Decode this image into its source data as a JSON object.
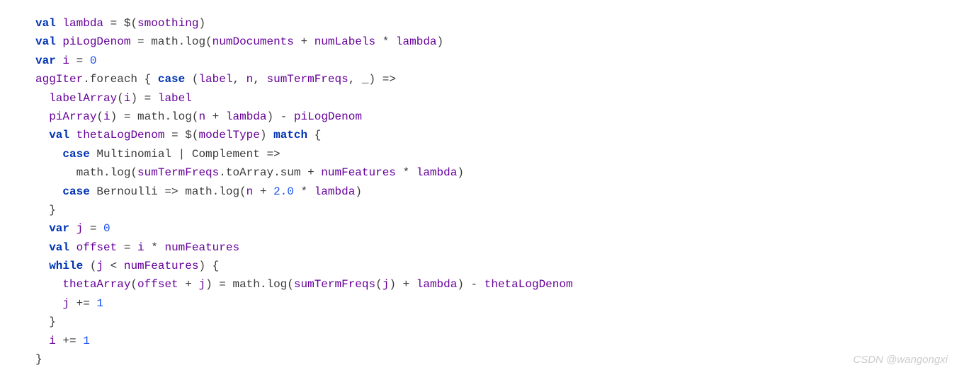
{
  "code": {
    "l1": {
      "kw1": "val",
      "v1": "lambda",
      "op1": " = $(",
      "v2": "smoothing",
      "op2": ")"
    },
    "l2": {
      "kw1": "val",
      "v1": "piLogDenom",
      "op1": " = math.log(",
      "v2": "numDocuments",
      "op2": " + ",
      "v3": "numLabels",
      "op3": " * ",
      "v4": "lambda",
      "op4": ")"
    },
    "l3": {
      "kw1": "var",
      "v1": "i",
      "op1": " = ",
      "n1": "0"
    },
    "l4": {
      "v1": "aggIter",
      "op1": ".foreach { ",
      "kw1": "case",
      "op2": " (",
      "v2": "label",
      "op3": ", ",
      "v3": "n",
      "op4": ", ",
      "v4": "sumTermFreqs",
      "op5": ", _) =>"
    },
    "l5": {
      "v1": "labelArray",
      "op1": "(",
      "v2": "i",
      "op2": ") = ",
      "v3": "label"
    },
    "l6": {
      "v1": "piArray",
      "op1": "(",
      "v2": "i",
      "op2": ") = math.log(",
      "v3": "n",
      "op3": " + ",
      "v4": "lambda",
      "op4": ") - ",
      "v5": "piLogDenom"
    },
    "l7": {
      "kw1": "val",
      "v1": "thetaLogDenom",
      "op1": " = $(",
      "v2": "modelType",
      "op2": ") ",
      "kw2": "match",
      "op3": " {"
    },
    "l8": {
      "kw1": "case",
      "op1": " Multinomial | Complement =>"
    },
    "l9": {
      "op1": "math.log(",
      "v1": "sumTermFreqs",
      "op2": ".toArray.sum + ",
      "v2": "numFeatures",
      "op3": " * ",
      "v3": "lambda",
      "op4": ")"
    },
    "l10": {
      "kw1": "case",
      "op1": " Bernoulli => math.log(",
      "v1": "n",
      "op2": " + ",
      "n1": "2.0",
      "op3": " * ",
      "v2": "lambda",
      "op4": ")"
    },
    "l11": {
      "op1": "}"
    },
    "l12": {
      "kw1": "var",
      "v1": "j",
      "op1": " = ",
      "n1": "0"
    },
    "l13": {
      "kw1": "val",
      "v1": "offset",
      "op1": " = ",
      "v2": "i",
      "op2": " * ",
      "v3": "numFeatures"
    },
    "l14": {
      "kw1": "while",
      "op1": " (",
      "v1": "j",
      "op2": " < ",
      "v2": "numFeatures",
      "op3": ") {"
    },
    "l15": {
      "v1": "thetaArray",
      "op1": "(",
      "v2": "offset",
      "op2": " + ",
      "v3": "j",
      "op3": ") = math.log(",
      "v4": "sumTermFreqs",
      "op4": "(",
      "v5": "j",
      "op5": ") + ",
      "v6": "lambda",
      "op6": ") - ",
      "v7": "thetaLogDenom"
    },
    "l16": {
      "v1": "j",
      "op1": " += ",
      "n1": "1"
    },
    "l17": {
      "op1": "}"
    },
    "l18": {
      "v1": "i",
      "op1": " += ",
      "n1": "1"
    },
    "l19": {
      "op1": "}"
    }
  },
  "watermark": "CSDN @wangongxi"
}
